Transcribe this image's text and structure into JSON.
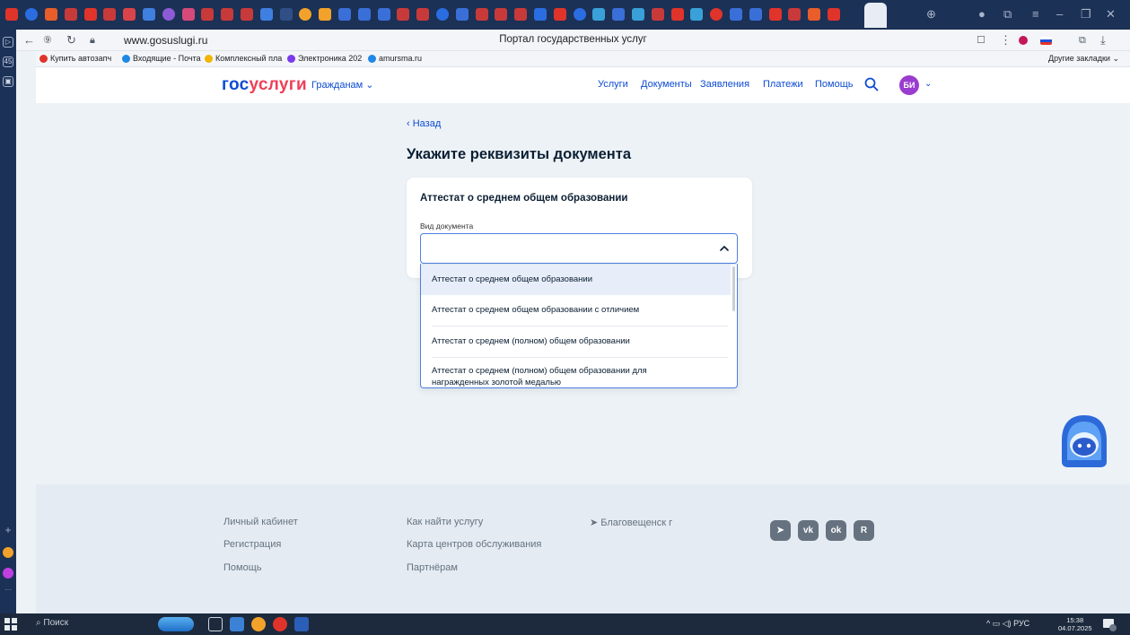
{
  "browser": {
    "url": "www.gosuslugi.ru",
    "tab_title": "Портал государственных услуг",
    "bookmarks": [
      {
        "label": "Купить автозапч",
        "color": "#e0342b"
      },
      {
        "label": "Входящие - Почта",
        "color": "#1e88e5"
      },
      {
        "label": "Комплексный пла",
        "color": "#f2b400"
      },
      {
        "label": "Электроника 202",
        "color": "#7c3aed"
      },
      {
        "label": "amursma.ru",
        "color": "#1e88e5"
      }
    ],
    "other_bookmarks": "Другие закладки"
  },
  "header": {
    "logo_part1": "гос",
    "logo_part2": "услуги",
    "audience": "Гражданам",
    "nav": [
      "Услуги",
      "Документы",
      "Заявления",
      "Платежи",
      "Помощь"
    ],
    "avatar_initials": "БИ"
  },
  "main": {
    "back_label": "‹ Назад",
    "title": "Укажите реквизиты документа",
    "card_title": "Аттестат о среднем общем образовании",
    "field_label": "Вид документа",
    "selected_value": "",
    "options": [
      "Аттестат о среднем общем образовании",
      "Аттестат о среднем общем образовании с отличием",
      "Аттестат о среднем (полном) общем образовании",
      "Аттестат о среднем (полном) общем образовании для",
      "награжденных золотой медалью"
    ]
  },
  "footer": {
    "col1": [
      "Личный кабинет",
      "Регистрация",
      "Помощь"
    ],
    "col2": [
      "Как найти услугу",
      "Карта центров обслуживания",
      "Партнёрам"
    ],
    "city": "Благовещенск г",
    "social": [
      "telegram-icon",
      "vk-icon",
      "ok-icon",
      "rutube-icon"
    ]
  },
  "taskbar": {
    "search_label": "Поиск",
    "lang": "РУС",
    "time": "15:38",
    "date": "04.07.2025"
  }
}
